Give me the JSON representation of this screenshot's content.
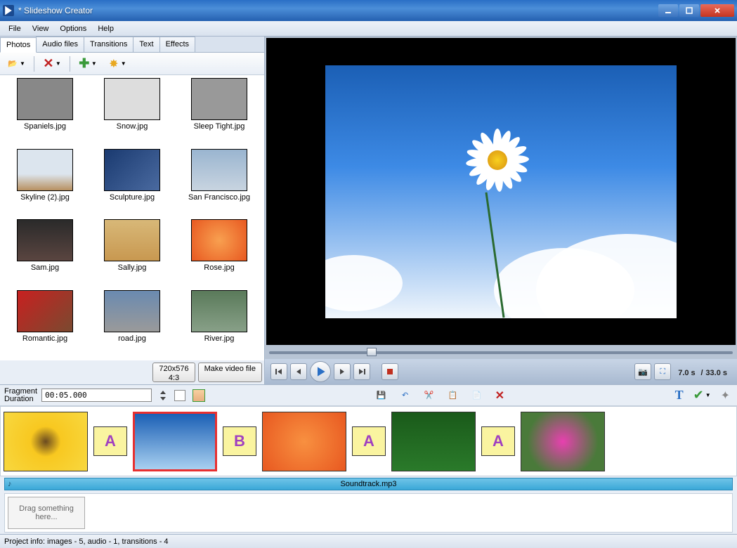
{
  "window": {
    "title": "* Slideshow Creator"
  },
  "menu": {
    "file": "File",
    "view": "View",
    "options": "Options",
    "help": "Help"
  },
  "tabs": {
    "photos": "Photos",
    "audio": "Audio files",
    "transitions": "Transitions",
    "text": "Text",
    "effects": "Effects"
  },
  "thumbs": [
    {
      "label": "Spaniels.jpg"
    },
    {
      "label": "Snow.jpg"
    },
    {
      "label": "Sleep Tight.jpg"
    },
    {
      "label": "Skyline (2).jpg"
    },
    {
      "label": "Sculpture.jpg"
    },
    {
      "label": "San Francisco.jpg"
    },
    {
      "label": "Sam.jpg"
    },
    {
      "label": "Sally.jpg"
    },
    {
      "label": "Rose.jpg"
    },
    {
      "label": "Romantic.jpg"
    },
    {
      "label": "road.jpg"
    },
    {
      "label": "River.jpg"
    }
  ],
  "resolution": {
    "res": "720x576",
    "ratio": "4:3"
  },
  "make_video": "Make video file",
  "time": {
    "current": "7.0 s",
    "sep": "/",
    "total": "33.0 s"
  },
  "fragment": {
    "label1": "Fragment",
    "label2": "Duration",
    "value": "00:05.000"
  },
  "audio": {
    "track": "Soundtrack.mp3"
  },
  "drag": {
    "text": "Drag something here..."
  },
  "status": "Project info: images - 5, audio - 1, transitions - 4",
  "transitions": [
    "A",
    "B",
    "A",
    "A"
  ]
}
